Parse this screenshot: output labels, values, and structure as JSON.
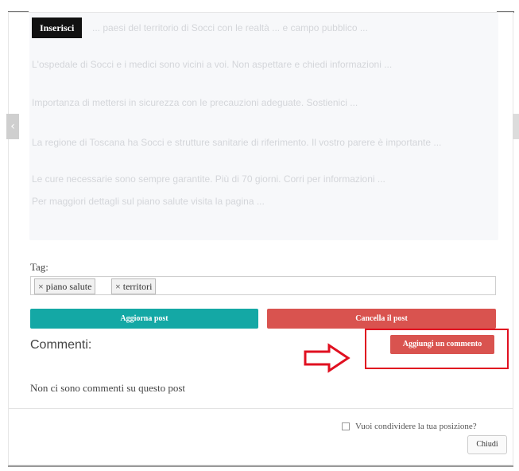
{
  "editor": {
    "insert_label": "Inserisci",
    "faded_text": [
      "... paesi del territorio di Socci con le realtà ... e campo pubblico ...",
      "L'ospedale di Socci e i medici sono vicini a voi. Non aspettare e chiedi informazioni ...",
      "Importanza di mettersi in sicurezza con le precauzioni adeguate. Sostienici ...",
      "La regione di Toscana ha Socci e strutture sanitarie di riferimento. Il vostro parere è importante ...",
      "Le cure necessarie sono sempre garantite. Più di 70 giorni. Corri per informazioni ...",
      "Per maggiori dettagli sul piano salute visita la pagina ..."
    ]
  },
  "tags": {
    "label": "Tag:",
    "items": [
      "× piano salute",
      "× territori"
    ]
  },
  "actions": {
    "update_label": "Aggiorna post",
    "delete_label": "Cancella il post"
  },
  "comments": {
    "title": "Commenti:",
    "add_label": "Aggiungi un commento",
    "empty_text": "Non ci sono commenti su questo post"
  },
  "footer": {
    "share_label": "Vuoi condividere la tua posizione?",
    "close_label": "Chiudi"
  },
  "colors": {
    "primary_teal": "#14a8a5",
    "danger_red": "#d9534f",
    "highlight_red": "#e01020"
  }
}
